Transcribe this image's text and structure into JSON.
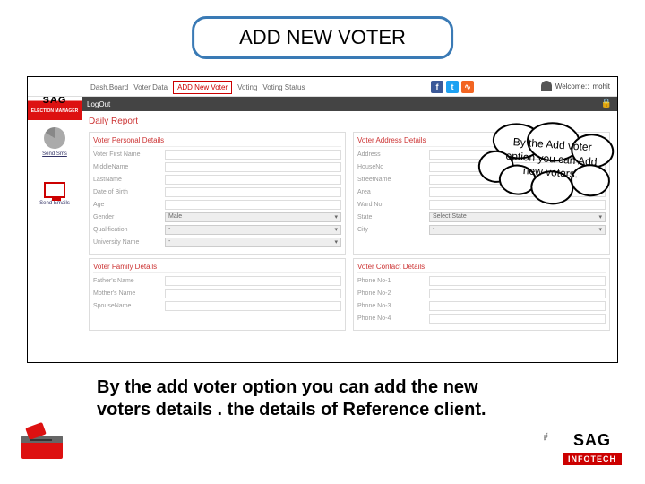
{
  "slide": {
    "title": "ADD NEW VOTER"
  },
  "topMenu": {
    "items": [
      "Dash.Board",
      "Voter Data"
    ],
    "addNew": "ADD New Voter",
    "items2": [
      "Voting",
      "Voting Status"
    ]
  },
  "welcome": {
    "label": "Welcome::",
    "user": "mohit"
  },
  "logout": "LogOut",
  "dailyReport": "Daily Report",
  "sidebar": {
    "sendSms": "Send Sms",
    "sendEmails": "Send Emails"
  },
  "sections": {
    "personal": {
      "head": "Voter Personal Details",
      "fields": [
        "Voter First Name",
        "MiddleName",
        "LastName",
        "Date of Birth",
        "Age",
        "Gender",
        "Qualification",
        "University Name"
      ],
      "gender": "Male"
    },
    "address": {
      "head": "Voter Address Details",
      "fields": [
        "Address",
        "HouseNo",
        "StreetName",
        "Area",
        "Ward No",
        "State",
        "City"
      ],
      "state": "Select State"
    },
    "family": {
      "head": "Voter Family Details",
      "fields": [
        "Father's Name",
        "Mother's Name",
        "SpouseName"
      ]
    },
    "contact": {
      "head": "Voter Contact Details",
      "fields": [
        "Phone No-1",
        "Phone No-2",
        "Phone No-3",
        "Phone No-4"
      ]
    }
  },
  "cloud": "By the Add voter option you  can Add new voters.",
  "caption": "By the add voter option you can add the new voters details . the details of Reference client.",
  "footer": {
    "brand": "SAG",
    "sub": "INFOTECH",
    "manager": "ELECTION MANAGER"
  }
}
